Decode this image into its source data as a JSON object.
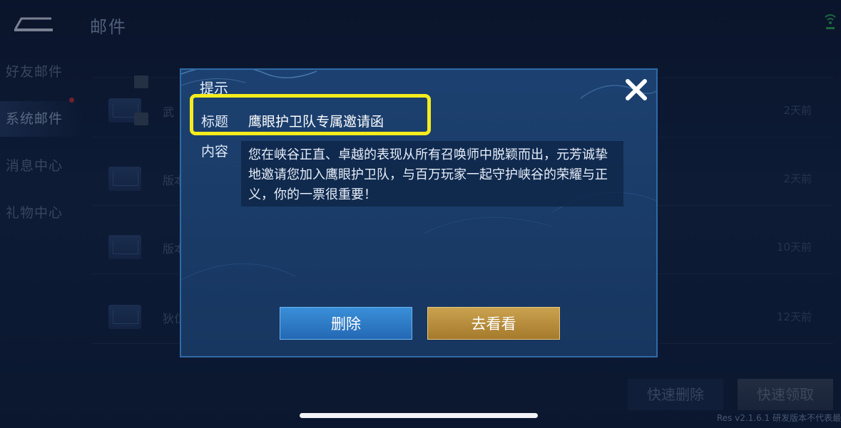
{
  "header": {
    "title": "邮件"
  },
  "sidebar": {
    "items": [
      {
        "label": "好友邮件"
      },
      {
        "label": "系统邮件"
      },
      {
        "label": "消息中心"
      },
      {
        "label": "礼物中心"
      }
    ]
  },
  "mail_list": {
    "rows": [
      {
        "subject": "",
        "age": ""
      },
      {
        "subject": "武",
        "age": "2天前"
      },
      {
        "subject": "版本",
        "age": "2天前"
      },
      {
        "subject": "版本更新补偿邮件",
        "age": "10天前"
      },
      {
        "subject": "狄仁",
        "age": "12天前"
      }
    ]
  },
  "footer": {
    "quick_delete": "快速删除",
    "quick_collect": "快速领取",
    "version": "Res v2.1.6.1 研发版本不代表最"
  },
  "dialog": {
    "title": "提示",
    "subject_label": "标题",
    "subject_value": "鹰眼护卫队专属邀请函",
    "content_label": "内容",
    "content_value": "您在峡谷正直、卓越的表现从所有召唤师中脱颖而出，元芳诚挚地邀请您加入鹰眼护卫队，与百万玩家一起守护峡谷的荣耀与正义，你的一票很重要！",
    "delete_button": "删除",
    "view_button": "去看看"
  },
  "colors": {
    "highlight": "#f5ec1d",
    "delete_button": "#2f7cc6",
    "view_button": "#b88e3d"
  }
}
